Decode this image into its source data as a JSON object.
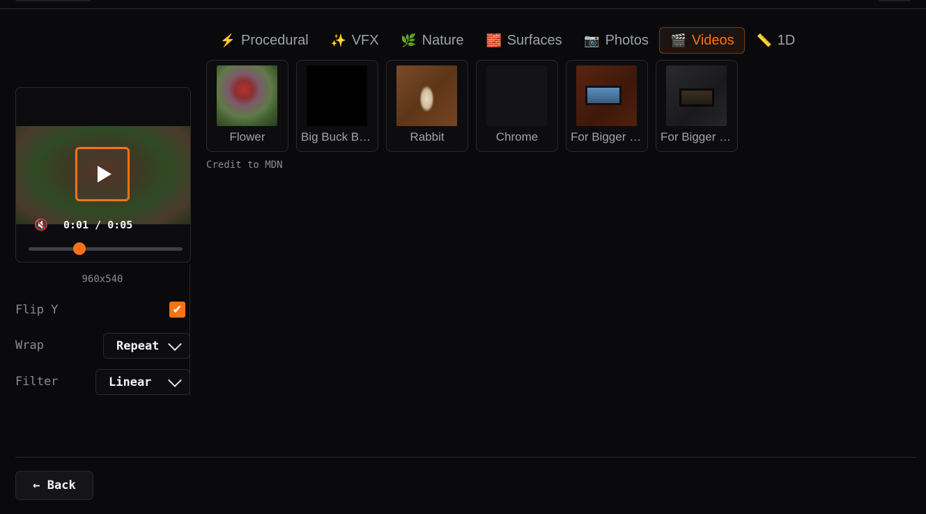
{
  "tabs": [
    {
      "icon": "⚡",
      "icon_name": "lightning-icon",
      "label": "Procedural"
    },
    {
      "icon": "✨",
      "icon_name": "sparkles-icon",
      "label": "VFX"
    },
    {
      "icon": "🌿",
      "icon_name": "herb-icon",
      "label": "Nature"
    },
    {
      "icon": "🧱",
      "icon_name": "brick-icon",
      "label": "Surfaces"
    },
    {
      "icon": "📷",
      "icon_name": "camera-icon",
      "label": "Photos"
    },
    {
      "icon": "🎬",
      "icon_name": "clapper-icon",
      "label": "Videos"
    },
    {
      "icon": "📏",
      "icon_name": "ruler-icon",
      "label": "1D"
    }
  ],
  "active_tab": "Videos",
  "player": {
    "time": "0:01 / 0:05",
    "progress": 0.33,
    "muted": true,
    "resolution": "960x540"
  },
  "options": {
    "flip_y_label": "Flip Y",
    "flip_y_checked": true,
    "wrap_label": "Wrap",
    "wrap_value": "Repeat",
    "filter_label": "Filter",
    "filter_value": "Linear"
  },
  "videos": [
    {
      "label": "Flower",
      "thumb": "flower"
    },
    {
      "label": "Big Buck Bunny",
      "thumb": "black"
    },
    {
      "label": "Rabbit",
      "thumb": "rabbit"
    },
    {
      "label": "Chrome",
      "thumb": "dark"
    },
    {
      "label": "For Bigger Blazes",
      "thumb": "table-red"
    },
    {
      "label": "For Bigger Escapes",
      "thumb": "table-dark"
    }
  ],
  "credit": "Credit to MDN",
  "back_label": "← Back",
  "colors": {
    "accent": "#f97316",
    "background": "#0a0a0c",
    "border": "#2a2a2e"
  }
}
